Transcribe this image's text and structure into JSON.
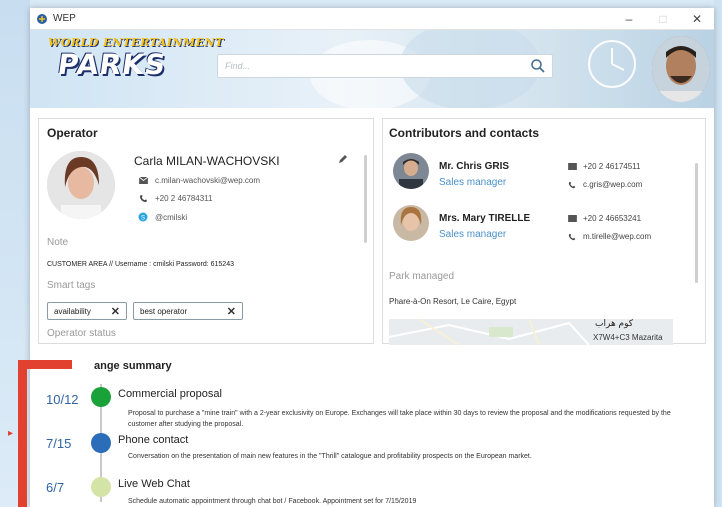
{
  "window": {
    "title": "WEP",
    "minimize": "–",
    "maximize": "□",
    "close": "✕"
  },
  "banner": {
    "logo_line1": "WORLD ENTERTAINMENT",
    "logo_line2": "PARKS",
    "search_placeholder": "Find..."
  },
  "operator": {
    "title": "Operator",
    "name": "Carla MILAN-WACHOVSKI",
    "email": "c.milan-wachovski@wep.com",
    "phone": "+20 2 46784311",
    "skype": "@cmilski",
    "note_label": "Note",
    "customer_area": "CUSTOMER AREA // Username : cmilski Password: 615243",
    "smart_tags_label": "Smart tags",
    "tags": [
      "availability",
      "best operator"
    ],
    "status_label": "Operator status"
  },
  "contributors": {
    "title": "Contributors and contacts",
    "contacts": [
      {
        "name": "Mr. Chris GRIS",
        "role": "Sales manager",
        "phone": "+20 2 46174511",
        "email": "c.gris@wep.com"
      },
      {
        "name": "Mrs. Mary TIRELLE",
        "role": "Sales manager",
        "phone": "+20 2 46653241",
        "email": "m.tirelle@wep.com"
      }
    ],
    "park_label": "Park managed",
    "park_address": "Phare-à-On Resort, Le Caire, Egypt",
    "map_arabic": "كوم هراب",
    "map_code": "X7W4+C3 Mazarita"
  },
  "change_summary": {
    "title": "ange summary",
    "events": [
      {
        "date": "10/12",
        "title": "Commercial proposal",
        "color": "#1aa23a",
        "desc": "Proposal to purchase a \"mine train\" with a 2-year exclusivity on Europe. Exchanges will take place within 30 days to review the proposal and the modifications requested by the customer after studying the proposal."
      },
      {
        "date": "7/15",
        "title": "Phone contact",
        "color": "#2b6db8",
        "desc": "Conversation on the presentation of main new features in the \"Thrill\" catalogue and profitability prospects on the European market."
      },
      {
        "date": "6/7",
        "title": "Live Web Chat",
        "color": "#d4e3a6",
        "desc": "Schedule automatic appointment through chat bot / Facebook. Appointment set for 7/15/2019"
      }
    ]
  },
  "colors": {
    "accent_red": "#e3412f",
    "link_blue": "#4a90c8",
    "date_blue": "#2f64a5"
  }
}
